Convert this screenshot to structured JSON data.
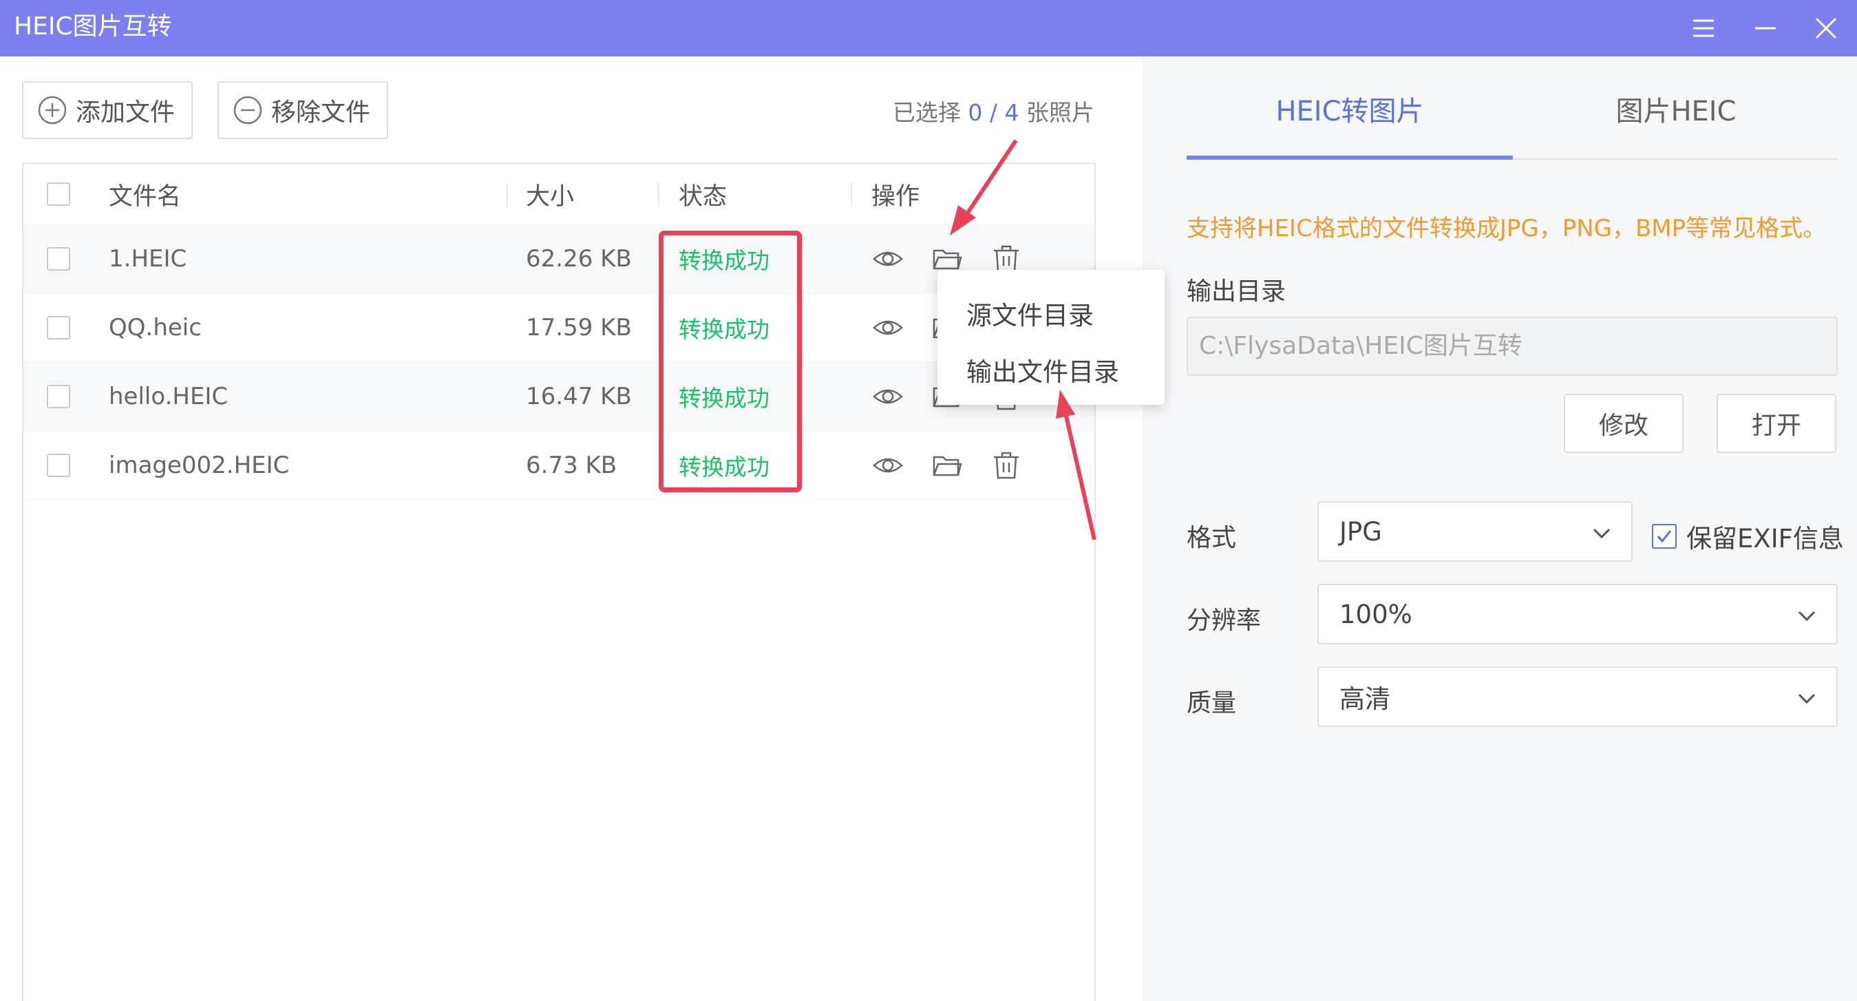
{
  "window": {
    "title": "HEIC图片互转",
    "colors": {
      "titlebar": "#7b7ff0",
      "accent": "#5b73d8",
      "success": "#1fbf6a",
      "hint": "#f29a2e",
      "highlight": "#e8425a"
    }
  },
  "toolbar": {
    "add_label": "添加文件",
    "remove_label": "移除文件",
    "selected_prefix": "已选择",
    "selected_count": "0 / 4",
    "selected_suffix": "张照片"
  },
  "table": {
    "headers": {
      "name": "文件名",
      "size": "大小",
      "status": "状态",
      "actions": "操作"
    },
    "rows": [
      {
        "name": "1.HEIC",
        "size": "62.26 KB",
        "status": "转换成功"
      },
      {
        "name": "QQ.heic",
        "size": "17.59 KB",
        "status": "转换成功"
      },
      {
        "name": "hello.HEIC",
        "size": "16.47 KB",
        "status": "转换成功"
      },
      {
        "name": "image002.HEIC",
        "size": "6.73 KB",
        "status": "转换成功"
      }
    ]
  },
  "context_menu": {
    "items": [
      "源文件目录",
      "输出文件目录"
    ]
  },
  "settings": {
    "tabs": [
      "HEIC转图片",
      "图片HEIC"
    ],
    "active_tab": 0,
    "hint": "支持将HEIC格式的文件转换成JPG，PNG，BMP等常见格式。",
    "output_dir_label": "输出目录",
    "output_dir_value": "C:\\FlysaData\\HEIC图片互转",
    "modify_label": "修改",
    "open_label": "打开",
    "format_label": "格式",
    "format_value": "JPG",
    "keep_exif_label": "保留EXIF信息",
    "keep_exif_checked": true,
    "resolution_label": "分辨率",
    "resolution_value": "100%",
    "quality_label": "质量",
    "quality_value": "高清"
  }
}
